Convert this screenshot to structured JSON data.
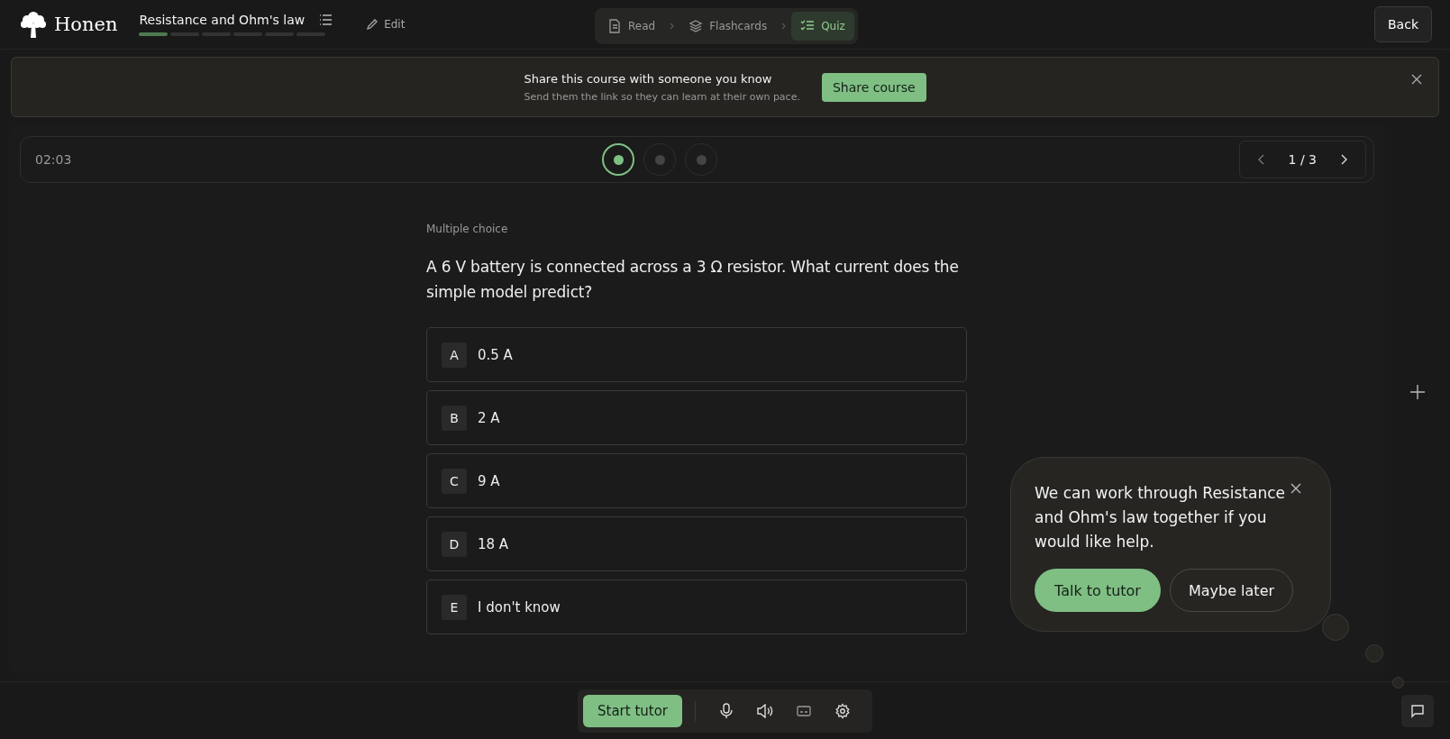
{
  "brand": {
    "name": "Honen"
  },
  "course": {
    "title": "Resistance and Ohm's law",
    "segments": [
      {
        "done": true
      },
      {
        "done": false
      },
      {
        "done": false
      },
      {
        "done": false
      },
      {
        "done": false
      },
      {
        "done": false
      }
    ]
  },
  "edit_label": "Edit",
  "modes": [
    {
      "label": "Read",
      "kind": "read",
      "selected": false
    },
    {
      "label": "Flashcards",
      "kind": "cards",
      "selected": false
    },
    {
      "label": "Quiz",
      "kind": "quiz",
      "selected": true
    }
  ],
  "back_label": "Back",
  "banner": {
    "title": "Share this course with someone you know",
    "subtitle": "Send them the link so they can learn at their own pace.",
    "button": "Share course"
  },
  "quiz": {
    "timer": "02:03",
    "steps": [
      {
        "selected": true
      },
      {
        "selected": false
      },
      {
        "selected": false
      }
    ],
    "page": "1 / 3",
    "type": "Multiple choice",
    "question": "A 6 V battery is connected across a 3 Ω resistor. What current does the simple model predict?",
    "options": [
      {
        "letter": "A",
        "text": "0.5 A",
        "selected": false
      },
      {
        "letter": "B",
        "text": "2 A",
        "selected": false
      },
      {
        "letter": "C",
        "text": "9 A",
        "selected": false
      },
      {
        "letter": "D",
        "text": "18 A",
        "selected": false
      },
      {
        "letter": "E",
        "text": "I don't know",
        "selected": false
      }
    ]
  },
  "tutor_popup": {
    "message": "We can work through Resistance and Ohm's law together if you would like help.",
    "primary": "Talk to tutor",
    "secondary": "Maybe later"
  },
  "toolbar": {
    "start": "Start tutor"
  }
}
